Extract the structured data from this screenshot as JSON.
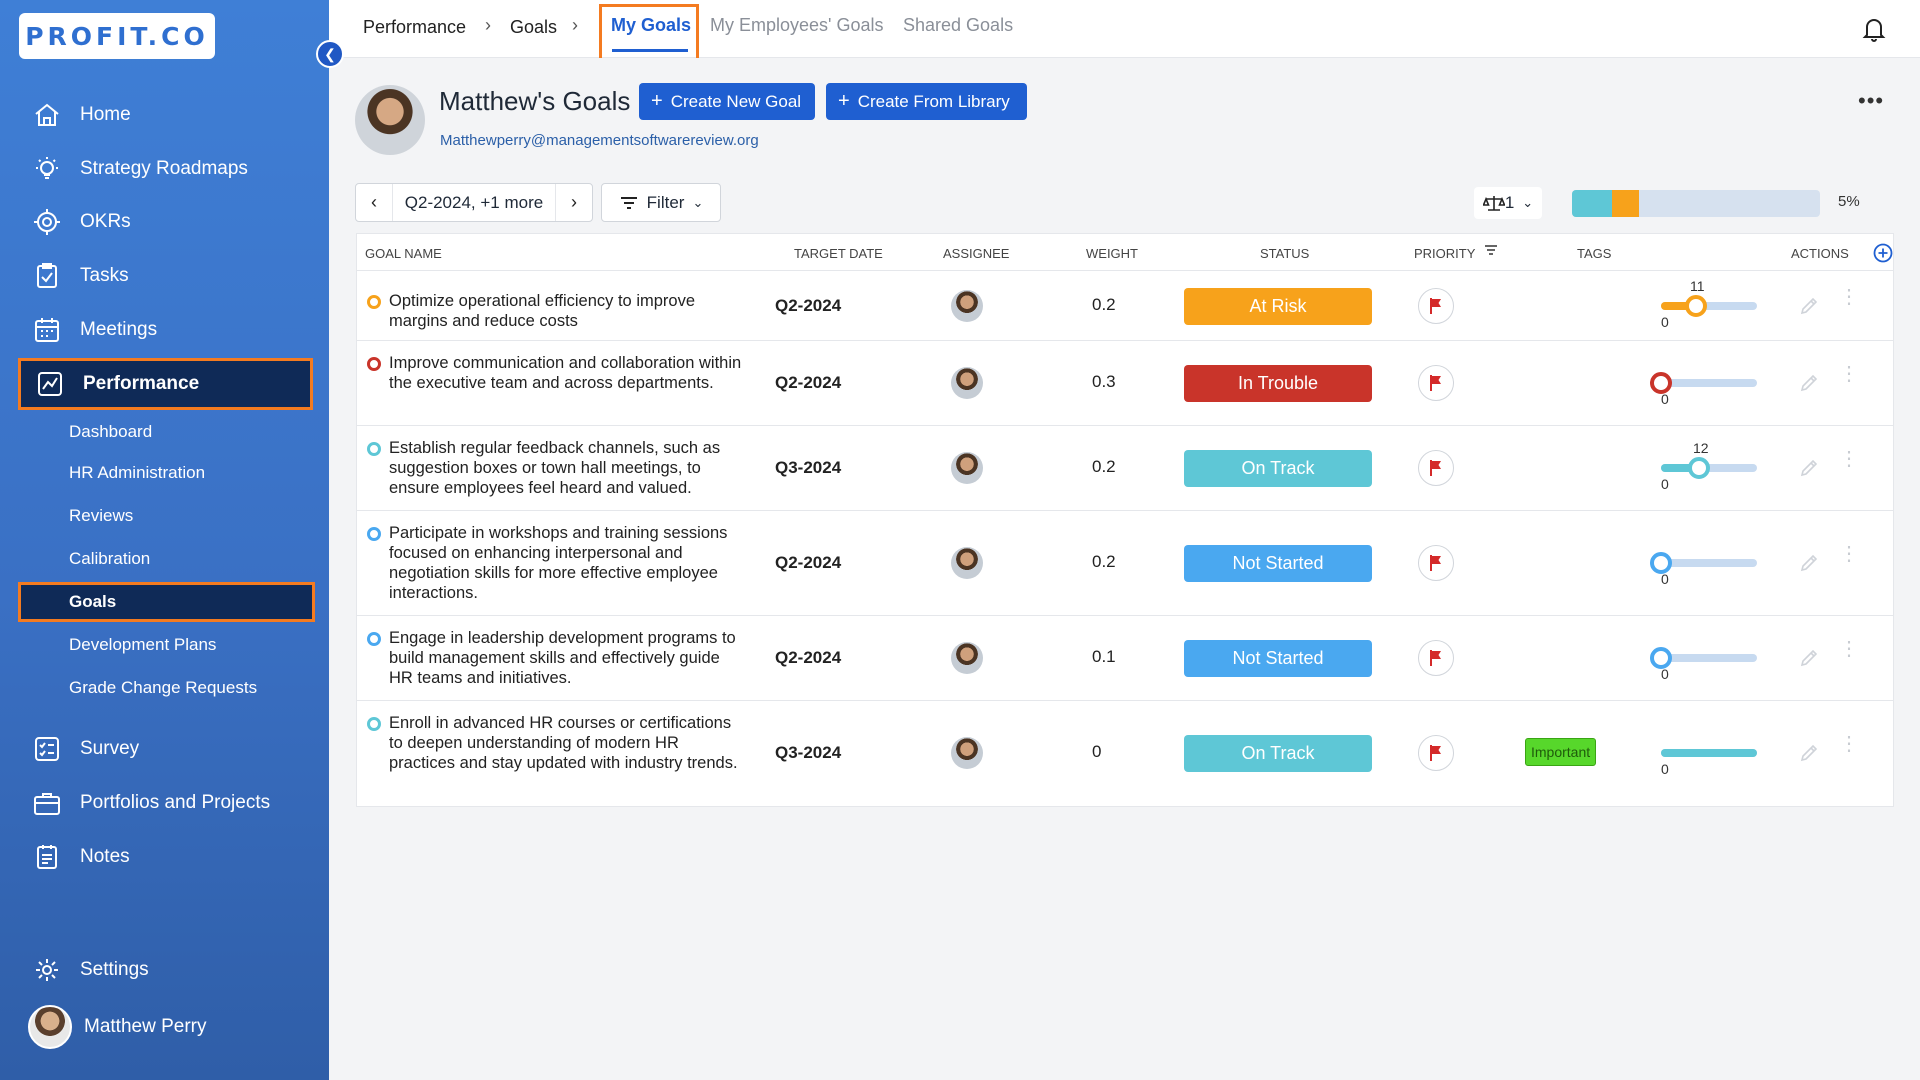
{
  "app": {
    "logo_text": "PROFIT.CO",
    "brand_color": "#1f5fd1",
    "highlight_color": "#f47b20"
  },
  "sidebar": {
    "items": [
      {
        "label": "Home",
        "icon": "home-icon"
      },
      {
        "label": "Strategy Roadmaps",
        "icon": "lightbulb-icon"
      },
      {
        "label": "OKRs",
        "icon": "target-icon"
      },
      {
        "label": "Tasks",
        "icon": "clipboard-check-icon"
      },
      {
        "label": "Meetings",
        "icon": "calendar-icon"
      },
      {
        "label": "Performance",
        "icon": "chart-line-icon"
      },
      {
        "label": "Survey",
        "icon": "checklist-icon"
      },
      {
        "label": "Portfolios and Projects",
        "icon": "briefcase-icon"
      },
      {
        "label": "Notes",
        "icon": "notes-icon"
      }
    ],
    "sub_items": [
      "Dashboard",
      "HR Administration",
      "Reviews",
      "Calibration",
      "Goals",
      "Development Plans",
      "Grade Change Requests"
    ],
    "settings_label": "Settings",
    "user_name": "Matthew Perry"
  },
  "topbar": {
    "breadcrumb": [
      "Performance",
      "Goals"
    ],
    "tabs": [
      "My Goals",
      "My Employees' Goals",
      "Shared Goals"
    ]
  },
  "header": {
    "title": "Matthew's Goals",
    "email": "Matthewperry@managementsoftwarereview.org",
    "create_new_label": "Create New Goal",
    "create_library_label": "Create From Library"
  },
  "toolbar": {
    "period_label": "Q2-2024, +1 more",
    "filter_label": "Filter",
    "weight_count": "1",
    "overall_percent": "5%",
    "progress_on_track": 0.16,
    "progress_at_risk": 0.11
  },
  "table": {
    "columns": [
      "GOAL NAME",
      "TARGET DATE",
      "ASSIGNEE",
      "WEIGHT",
      "STATUS",
      "PRIORITY",
      "TAGS",
      "ACTIONS"
    ],
    "rows": [
      {
        "name": "Optimize operational efficiency to improve margins and reduce costs",
        "target": "Q2-2024",
        "weight": "0.2",
        "status": "At Risk",
        "status_color": "#f7a21b",
        "dot_color": "#f7a21b",
        "progress": 11,
        "progress_label": "11",
        "start": "0",
        "tag": ""
      },
      {
        "name": "Improve communication and collaboration within the executive team and across departments.",
        "target": "Q2-2024",
        "weight": "0.3",
        "status": "In Trouble",
        "status_color": "#c9342a",
        "dot_color": "#c9342a",
        "progress": 0,
        "progress_label": "",
        "start": "0",
        "tag": ""
      },
      {
        "name": "Establish regular feedback channels, such as suggestion boxes or town hall meetings, to ensure employees feel heard and valued.",
        "target": "Q3-2024",
        "weight": "0.2",
        "status": "On Track",
        "status_color": "#5ec7d6",
        "dot_color": "#5ec7d6",
        "progress": 12,
        "progress_label": "12",
        "start": "0",
        "tag": ""
      },
      {
        "name": "Participate in workshops and training sessions focused on enhancing interpersonal and negotiation skills for more effective employee interactions.",
        "target": "Q2-2024",
        "weight": "0.2",
        "status": "Not Started",
        "status_color": "#4aa8f0",
        "dot_color": "#4aa8f0",
        "progress": 0,
        "progress_label": "",
        "start": "0",
        "tag": ""
      },
      {
        "name": "Engage in leadership development programs to build management skills and effectively guide HR teams and initiatives.",
        "target": "Q2-2024",
        "weight": "0.1",
        "status": "Not Started",
        "status_color": "#4aa8f0",
        "dot_color": "#4aa8f0",
        "progress": 0,
        "progress_label": "",
        "start": "0",
        "tag": ""
      },
      {
        "name": "Enroll in advanced HR courses or certifications to deepen understanding of modern HR practices and stay updated with industry trends.",
        "target": "Q3-2024",
        "weight": "0",
        "status": "On Track",
        "status_color": "#5ec7d6",
        "dot_color": "#5ec7d6",
        "progress": 100,
        "progress_label": "",
        "start": "0",
        "tag": "Important"
      }
    ]
  }
}
